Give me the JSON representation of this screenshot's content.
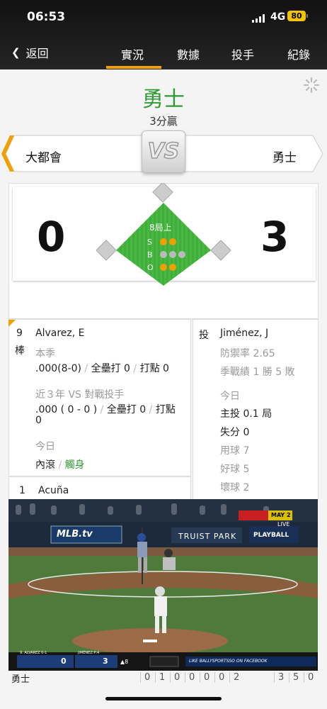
{
  "status": {
    "time": "06:53",
    "network": "4G",
    "battery": "80"
  },
  "nav": {
    "back_label": "返回",
    "tabs": [
      {
        "label": "實況"
      },
      {
        "label": "數據"
      },
      {
        "label": "投手"
      },
      {
        "label": "紀錄"
      }
    ]
  },
  "result": {
    "winner": "勇士",
    "margin": "3分贏"
  },
  "teams": {
    "away": "大都會",
    "home": "勇士",
    "vs": "VS"
  },
  "scoreboard": {
    "away_score": "0",
    "home_score": "3",
    "inning": "8局上",
    "labels": [
      "S",
      "B",
      "O"
    ],
    "strikes": 2,
    "balls": 0,
    "outs": 2
  },
  "batter": {
    "order": "9",
    "order_suffix": "棒",
    "name": "Alvarez, E",
    "season_label": "本季",
    "season_avg": ".000(8-0)",
    "season_hr_label": "全壘打",
    "season_hr": "0",
    "season_rbi_label": "打點",
    "season_rbi": "0",
    "vs_label": "近３年 VS 對戰投手",
    "vs_avg": ".000 ( 0 - 0 )",
    "vs_hr_label": "全壘打",
    "vs_hr": "0",
    "vs_rbi_label": "打點",
    "vs_rbi": "0",
    "today_label": "今日",
    "today_result1": "內滾",
    "today_result2": "觸身"
  },
  "next_batter": {
    "order": "1",
    "name": "Acuña"
  },
  "pitcher": {
    "role": "投",
    "name": "Jiménez, J",
    "era_label": "防禦率",
    "era": "2.65",
    "record_label": "季戰績",
    "record": "1 勝 5 敗",
    "today_label": "今日",
    "ip_label": "主投",
    "ip": "0.1 局",
    "er_label": "失分",
    "er": "0",
    "pitches_label": "用球",
    "pitches": "7",
    "strikes_label": "好球",
    "strikes": "5",
    "balls_label": "壞球",
    "balls": "2"
  },
  "video": {
    "banner_left": "MLB.tv",
    "banner_center": "TRUIST PARK",
    "banner_right": "PLAYBALL",
    "scorebug_away_label": "9. ALVAREZ 0-1",
    "scorebug_away_score": "0",
    "scorebug_home_label": "JIMÉNEZ P:4",
    "scorebug_home_score": "3",
    "scorebug_inning": "▲8",
    "scorebug_promo": "LIKE BALLYSPORTSSO ON FACEBOOK",
    "corner_badge": "MAY 2",
    "corner_live": "LIVE"
  },
  "bottom_row": {
    "team": "勇士",
    "innings": [
      "0",
      "1",
      "0",
      "0",
      "0",
      "0",
      "2",
      "",
      "",
      "3",
      "5",
      "0"
    ]
  }
}
